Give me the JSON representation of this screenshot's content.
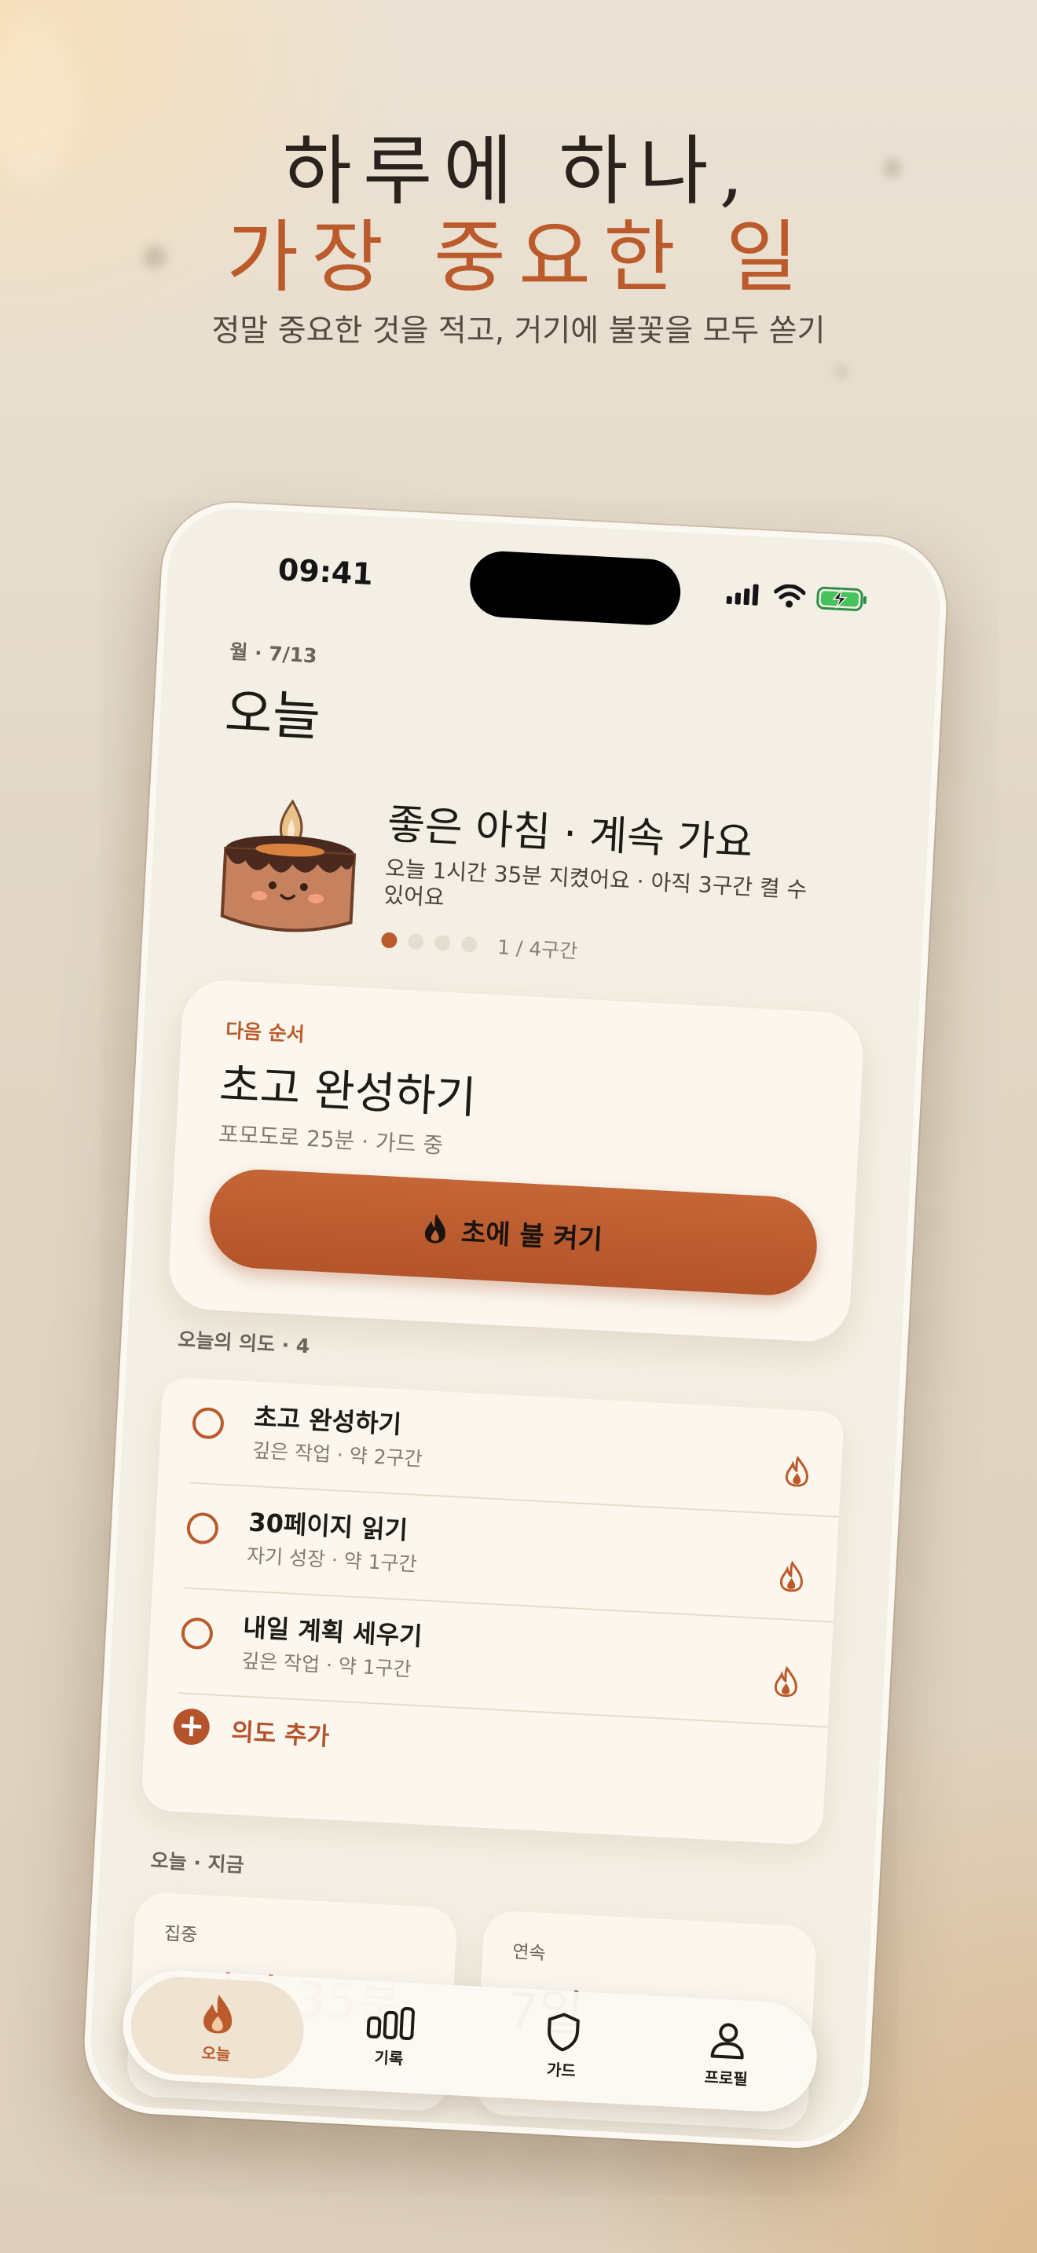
{
  "hero": {
    "line1": "하루에 하나,",
    "line2": "가장 중요한 일",
    "subtitle": "정말 중요한 것을 적고, 거기에 불꽃을 모두 쏟기"
  },
  "status_bar": {
    "time": "09:41"
  },
  "header": {
    "date": "월 · 7/13",
    "title": "오늘"
  },
  "greeting": {
    "title": "좋은 아침 · 계속 가요",
    "subtitle": "오늘 1시간 35분 지켰어요 · 아직 3구간 켤 수 있어요",
    "page_indicator": "1 / 4구간",
    "pages_total": 4,
    "page_current": 1
  },
  "next_up": {
    "label": "다음 순서",
    "title": "초고 완성하기",
    "meta": "포모도로 25분 · 가드 중",
    "button_label": "초에 불 켜기"
  },
  "intentions": {
    "section_label": "오늘의 의도 · 4",
    "items": [
      {
        "name": "초고 완성하기",
        "meta": "깊은 작업 · 약 2구간"
      },
      {
        "name": "30페이지 읽기",
        "meta": "자기 성장 · 약 1구간"
      },
      {
        "name": "내일 계획 세우기",
        "meta": "깊은 작업 · 약 1구간"
      }
    ],
    "add_label": "의도 추가"
  },
  "now": {
    "section_label": "오늘 · 지금",
    "focus_label": "집중",
    "focus_value": "1시간 35분",
    "streak_label": "연속",
    "streak_value": "7일"
  },
  "tabbar": {
    "tabs": [
      {
        "label": "오늘",
        "icon": "flame-icon"
      },
      {
        "label": "기록",
        "icon": "bar-chart-icon"
      },
      {
        "label": "가드",
        "icon": "shield-icon"
      },
      {
        "label": "프로필",
        "icon": "person-icon"
      }
    ]
  },
  "colors": {
    "accent": "#bb5a2a",
    "background": "#e4d9c8",
    "card": "#fbf7ef"
  }
}
